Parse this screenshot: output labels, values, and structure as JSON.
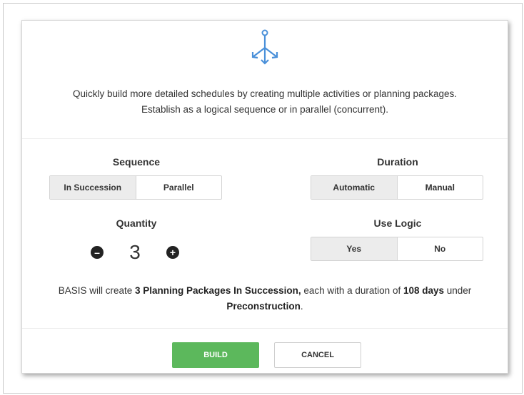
{
  "intro": {
    "icon": "sequence-split-icon",
    "line1": "Quickly build more detailed schedules by creating multiple activities or planning packages.",
    "line2": "Establish as a logical sequence or in parallel (concurrent)."
  },
  "sequence": {
    "label": "Sequence",
    "options": [
      "In Succession",
      "Parallel"
    ],
    "selected": "In Succession"
  },
  "duration": {
    "label": "Duration",
    "options": [
      "Automatic",
      "Manual"
    ],
    "selected": "Automatic"
  },
  "quantity": {
    "label": "Quantity",
    "value": "3",
    "minus_icon": "minus-circle-icon",
    "plus_icon": "plus-circle-icon"
  },
  "use_logic": {
    "label": "Use Logic",
    "options": [
      "Yes",
      "No"
    ],
    "selected": "Yes"
  },
  "summary": {
    "part1": "BASIS will create ",
    "bold1": "3 Planning Packages In Succession,",
    "part2": " each with a duration of ",
    "bold2": "108 days",
    "part3": " under",
    "bold3": "Preconstruction",
    "part4": "."
  },
  "buttons": {
    "build": "BUILD",
    "cancel": "CANCEL"
  },
  "colors": {
    "build_green": "#5cb85c",
    "icon_blue": "#4a90d9",
    "active_segment": "#ececec"
  }
}
